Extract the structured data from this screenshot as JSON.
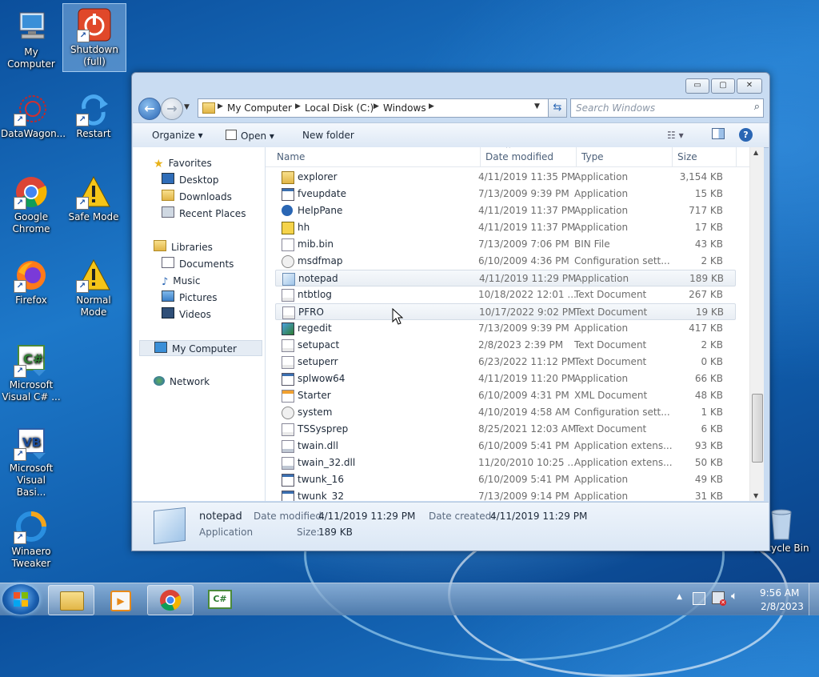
{
  "desktop": {
    "icons": [
      {
        "label": "My Computer"
      },
      {
        "label": "Shutdown (full)"
      },
      {
        "label": "DataWagon..."
      },
      {
        "label": "Restart"
      },
      {
        "label": "Google Chrome"
      },
      {
        "label": "Safe Mode"
      },
      {
        "label": "Firefox"
      },
      {
        "label": "Normal Mode"
      },
      {
        "label": "Microsoft Visual C# ..."
      },
      {
        "label": "Microsoft Visual Basi..."
      },
      {
        "label": "Winaero Tweaker"
      },
      {
        "label": "Recycle Bin"
      }
    ]
  },
  "explorer": {
    "window_buttons": {
      "minimize": "▭",
      "maximize": "▢",
      "close": "✕"
    },
    "breadcrumb": [
      "My Computer",
      "Local Disk (C:)",
      "Windows"
    ],
    "search_placeholder": "Search Windows",
    "toolbar": {
      "organize": "Organize",
      "open": "Open",
      "new_folder": "New folder",
      "help": "?"
    },
    "nav_pane": {
      "favorites": "Favorites",
      "favorites_items": [
        "Desktop",
        "Downloads",
        "Recent Places"
      ],
      "libraries": "Libraries",
      "libraries_items": [
        "Documents",
        "Music",
        "Pictures",
        "Videos"
      ],
      "computer": "My Computer",
      "network": "Network"
    },
    "columns": {
      "name": "Name",
      "date": "Date modified",
      "type": "Type",
      "size": "Size"
    },
    "files": [
      {
        "name": "explorer",
        "date": "4/11/2019 11:35 PM",
        "type": "Application",
        "size": "3,154 KB",
        "icon": "folder-app-icon"
      },
      {
        "name": "fveupdate",
        "date": "7/13/2009 9:39 PM",
        "type": "Application",
        "size": "15 KB",
        "icon": "app-icon"
      },
      {
        "name": "HelpPane",
        "date": "4/11/2019 11:37 PM",
        "type": "Application",
        "size": "717 KB",
        "icon": "help-icon"
      },
      {
        "name": "hh",
        "date": "4/11/2019 11:37 PM",
        "type": "Application",
        "size": "17 KB",
        "icon": "help-file-icon"
      },
      {
        "name": "mib.bin",
        "date": "7/13/2009 7:06 PM",
        "type": "BIN File",
        "size": "43 KB",
        "icon": "file-icon"
      },
      {
        "name": "msdfmap",
        "date": "6/10/2009 4:36 PM",
        "type": "Configuration sett...",
        "size": "2 KB",
        "icon": "config-icon"
      },
      {
        "name": "notepad",
        "date": "4/11/2019 11:29 PM",
        "type": "Application",
        "size": "189 KB",
        "icon": "notepad-icon"
      },
      {
        "name": "ntbtlog",
        "date": "10/18/2022 12:01 ...",
        "type": "Text Document",
        "size": "267 KB",
        "icon": "text-icon"
      },
      {
        "name": "PFRO",
        "date": "10/17/2022 9:02 PM",
        "type": "Text Document",
        "size": "19 KB",
        "icon": "text-icon"
      },
      {
        "name": "regedit",
        "date": "7/13/2009 9:39 PM",
        "type": "Application",
        "size": "417 KB",
        "icon": "regedit-icon"
      },
      {
        "name": "setupact",
        "date": "2/8/2023 2:39 PM",
        "type": "Text Document",
        "size": "2 KB",
        "icon": "text-icon"
      },
      {
        "name": "setuperr",
        "date": "6/23/2022 11:12 PM",
        "type": "Text Document",
        "size": "0 KB",
        "icon": "text-icon"
      },
      {
        "name": "splwow64",
        "date": "4/11/2019 11:20 PM",
        "type": "Application",
        "size": "66 KB",
        "icon": "app-icon"
      },
      {
        "name": "Starter",
        "date": "6/10/2009 4:31 PM",
        "type": "XML Document",
        "size": "48 KB",
        "icon": "xml-icon"
      },
      {
        "name": "system",
        "date": "4/10/2019 4:58 AM",
        "type": "Configuration sett...",
        "size": "1 KB",
        "icon": "config-icon"
      },
      {
        "name": "TSSysprep",
        "date": "8/25/2021 12:03 AM",
        "type": "Text Document",
        "size": "6 KB",
        "icon": "text-icon"
      },
      {
        "name": "twain.dll",
        "date": "6/10/2009 5:41 PM",
        "type": "Application extens...",
        "size": "93 KB",
        "icon": "dll-icon"
      },
      {
        "name": "twain_32.dll",
        "date": "11/20/2010 10:25 ...",
        "type": "Application extens...",
        "size": "50 KB",
        "icon": "dll-icon"
      },
      {
        "name": "twunk_16",
        "date": "6/10/2009 5:41 PM",
        "type": "Application",
        "size": "49 KB",
        "icon": "app-icon"
      },
      {
        "name": "twunk_32",
        "date": "7/13/2009 9:14 PM",
        "type": "Application",
        "size": "31 KB",
        "icon": "app-icon"
      }
    ],
    "details": {
      "name": "notepad",
      "kind": "Application",
      "modified_label": "Date modified:",
      "modified": "4/11/2019 11:29 PM",
      "created_label": "Date created:",
      "created": "4/11/2019 11:29 PM",
      "size_label": "Size:",
      "size": "189 KB"
    }
  },
  "taskbar": {
    "time": "9:56 AM",
    "date": "2/8/2023"
  }
}
